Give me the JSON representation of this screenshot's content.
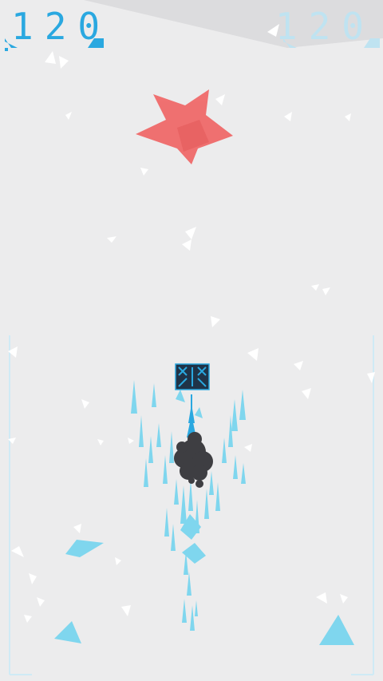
{
  "hud": {
    "score_left": "120",
    "score_right": "120"
  },
  "colors": {
    "background": "#ececed",
    "accent": "#2aa8e0",
    "ice": "#7fd6ee",
    "enemy": "#f06a6a",
    "smoke": "#3e3e42",
    "shard": "#ffffff",
    "frame": "#cfeaf5"
  },
  "icons": {
    "pause": "pause-icon",
    "player": "player-ship-icon",
    "enemy": "enemy-star-icon"
  }
}
